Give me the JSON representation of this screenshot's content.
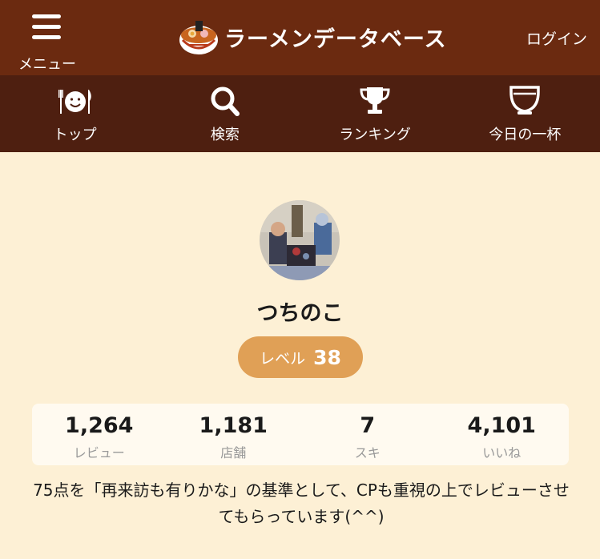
{
  "header": {
    "menu_label": "メニュー",
    "site_title": "ラーメンデータベース",
    "login_label": "ログイン",
    "background": "#6b2a10"
  },
  "nav": {
    "background": "#4e1f10",
    "items": [
      {
        "label": "トップ",
        "icon": "smile-plate-icon"
      },
      {
        "label": "検索",
        "icon": "search-icon"
      },
      {
        "label": "ランキング",
        "icon": "trophy-icon"
      },
      {
        "label": "今日の一杯",
        "icon": "bowl-icon"
      }
    ]
  },
  "profile": {
    "username": "つちのこ",
    "level_label": "レベル",
    "level_value": "38",
    "badge_color": "#e0a056",
    "stats": [
      {
        "value": "1,264",
        "label": "レビュー"
      },
      {
        "value": "1,181",
        "label": "店舗"
      },
      {
        "value": "7",
        "label": "スキ"
      },
      {
        "value": "4,101",
        "label": "いいね"
      }
    ],
    "bio": "75点を「再来訪も有りかな」の基準として、CPも重視の上でレビューさせてもらっています(^^)"
  }
}
